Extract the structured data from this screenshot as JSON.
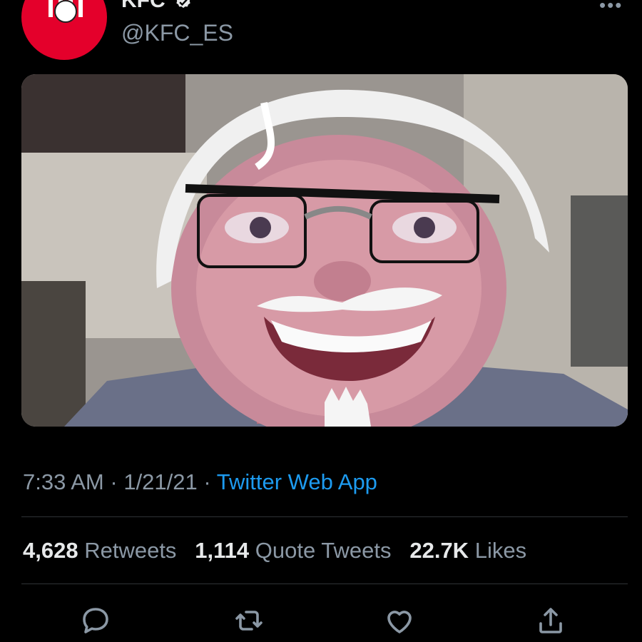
{
  "author": {
    "display_name": "KFC",
    "handle": "@KFC_ES",
    "avatar_text": "KFC",
    "verified": true
  },
  "tweet": {
    "time": "7:33 AM",
    "separator": "·",
    "date": "1/21/21",
    "app": "Twitter Web App"
  },
  "stats": {
    "retweets_count": "4,628",
    "retweets_label": "Retweets",
    "quotes_count": "1,114",
    "quotes_label": "Quote Tweets",
    "likes_count": "22.7K",
    "likes_label": "Likes"
  },
  "colors": {
    "background": "#000000",
    "link": "#1d9bf0",
    "muted": "#8b98a5",
    "brand_red": "#e4002b"
  },
  "icons": [
    "verified-icon",
    "more-icon",
    "reply-icon",
    "retweet-icon",
    "like-icon",
    "share-icon"
  ]
}
